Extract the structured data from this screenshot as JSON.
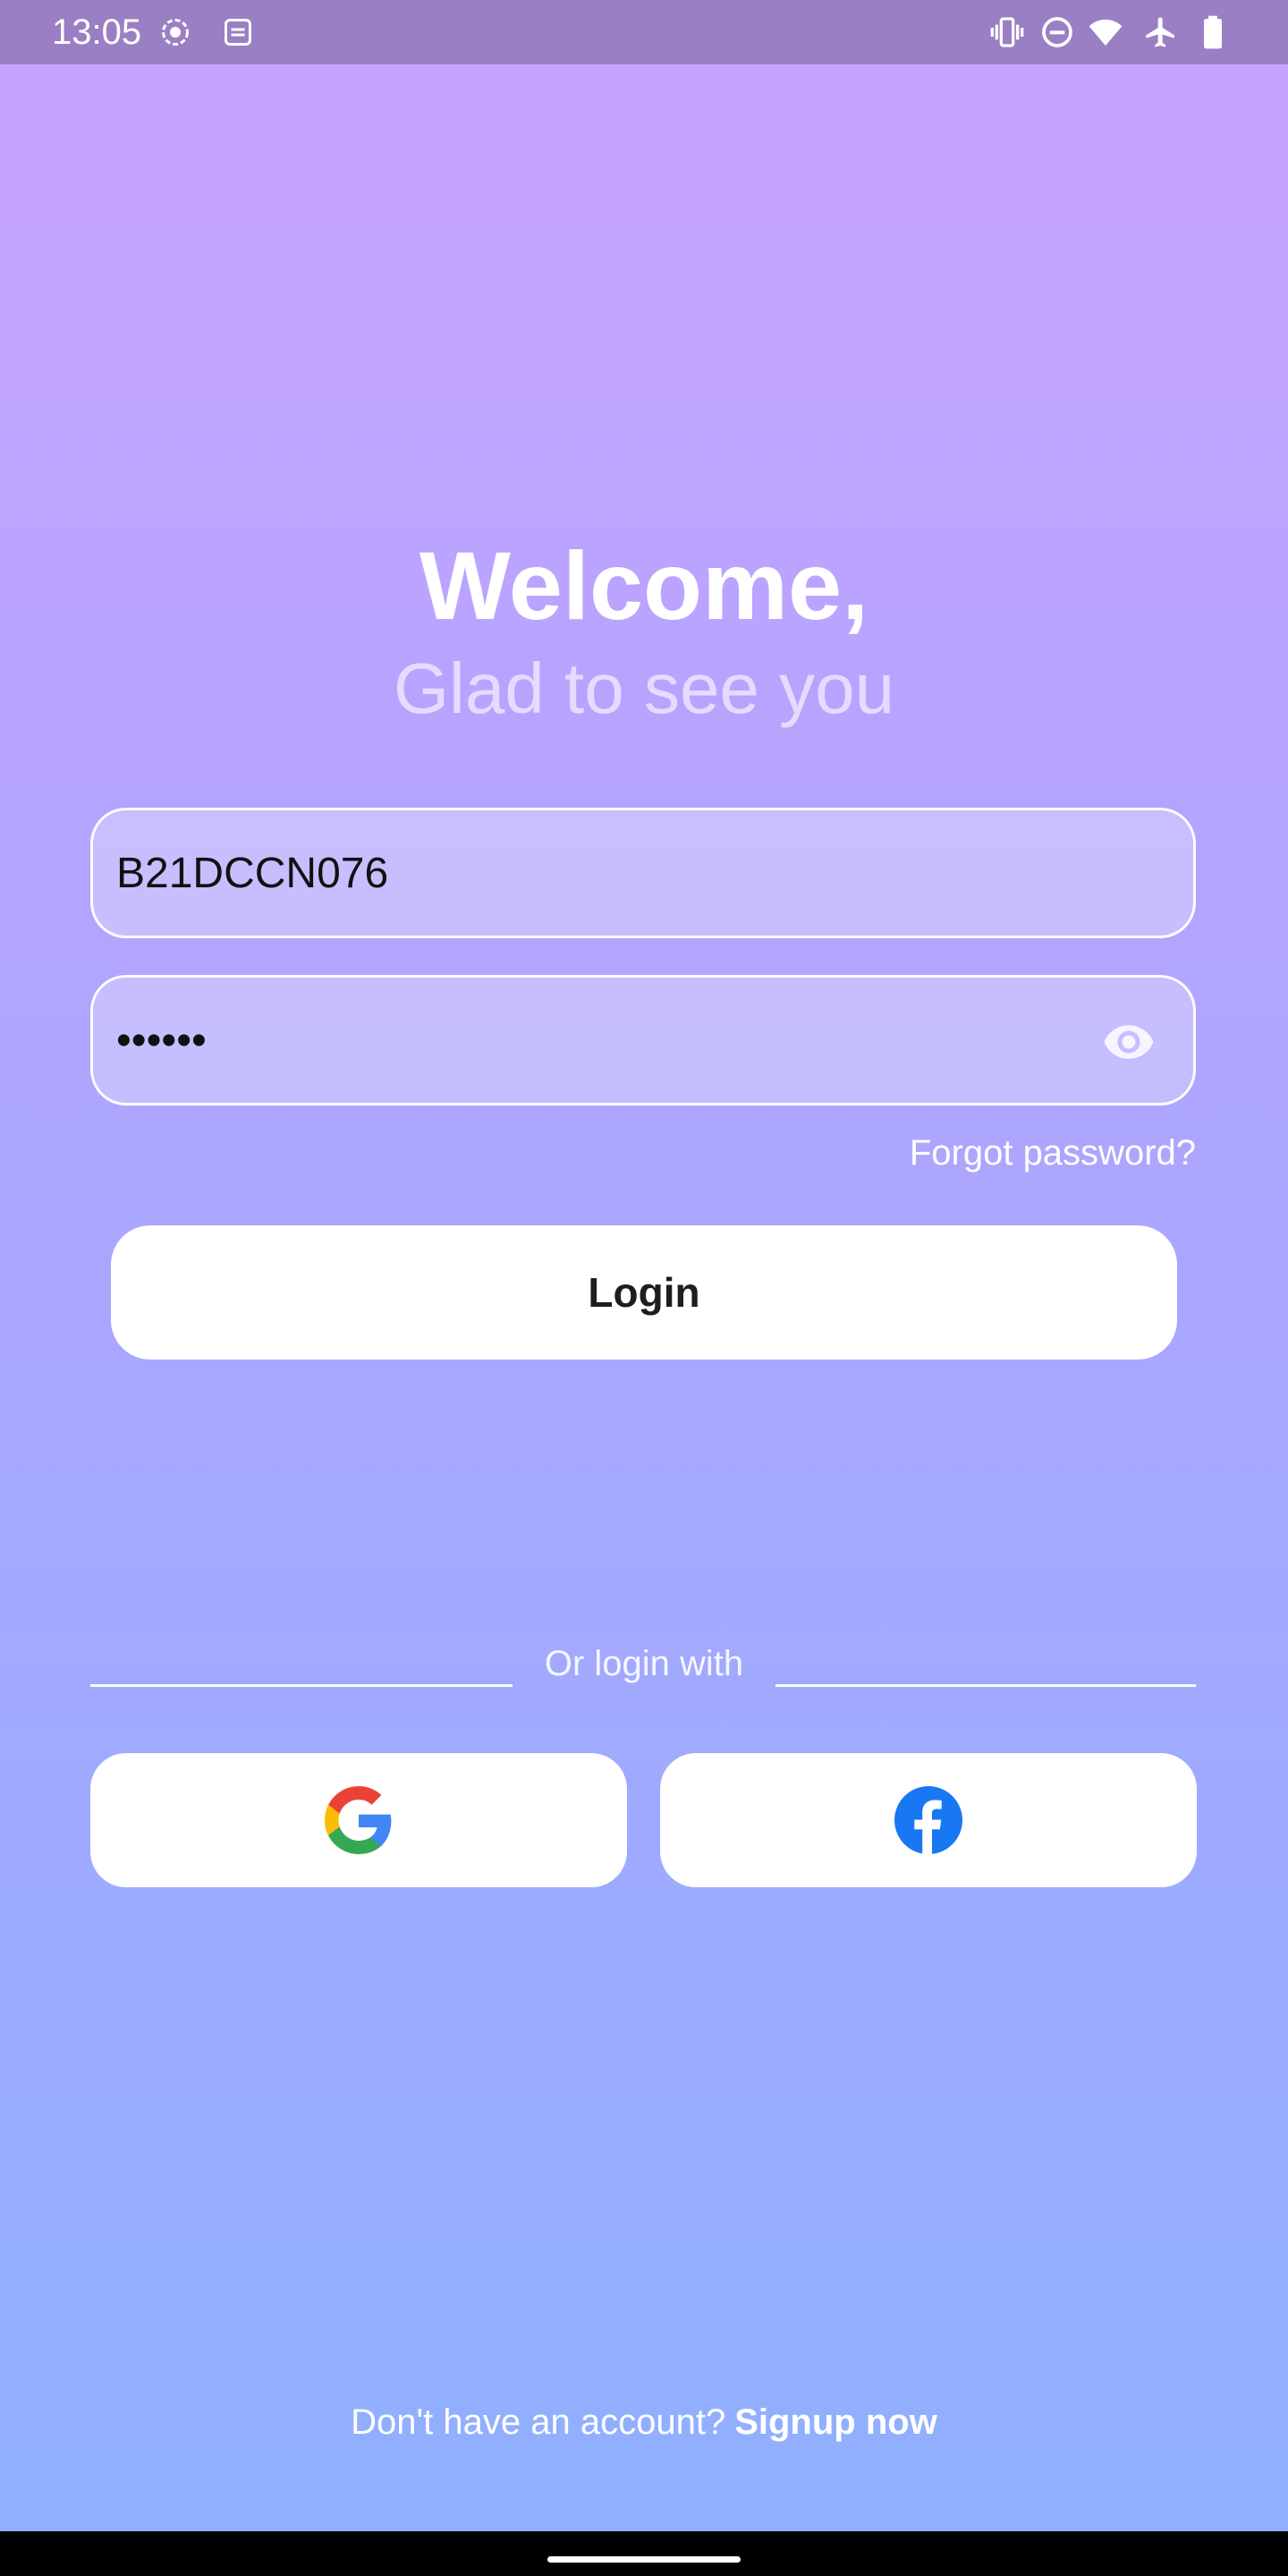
{
  "status_bar": {
    "time": "13:05",
    "left_icons": [
      "screen-record-icon",
      "app-notification-icon"
    ],
    "right_icons": [
      "vibrate-icon",
      "do-not-disturb-icon",
      "wifi-icon",
      "airplane-mode-icon",
      "battery-icon"
    ]
  },
  "header": {
    "title": "Welcome,",
    "subtitle": "Glad to see you"
  },
  "form": {
    "username_value": "B21DCCN076",
    "password_value": "••••••",
    "forgot_password": "Forgot password?",
    "login_label": "Login"
  },
  "divider": {
    "text": "Or login with"
  },
  "social": {
    "google_icon": "google-icon",
    "facebook_icon": "facebook-icon"
  },
  "footer": {
    "prompt": "Don't have an account?",
    "signup_link": "Signup now"
  },
  "colors": {
    "gradient_top": "#c8a2ff",
    "gradient_bottom": "#8fb0ff",
    "status_bar": "#9a7fc4",
    "facebook_blue": "#1877f2"
  }
}
